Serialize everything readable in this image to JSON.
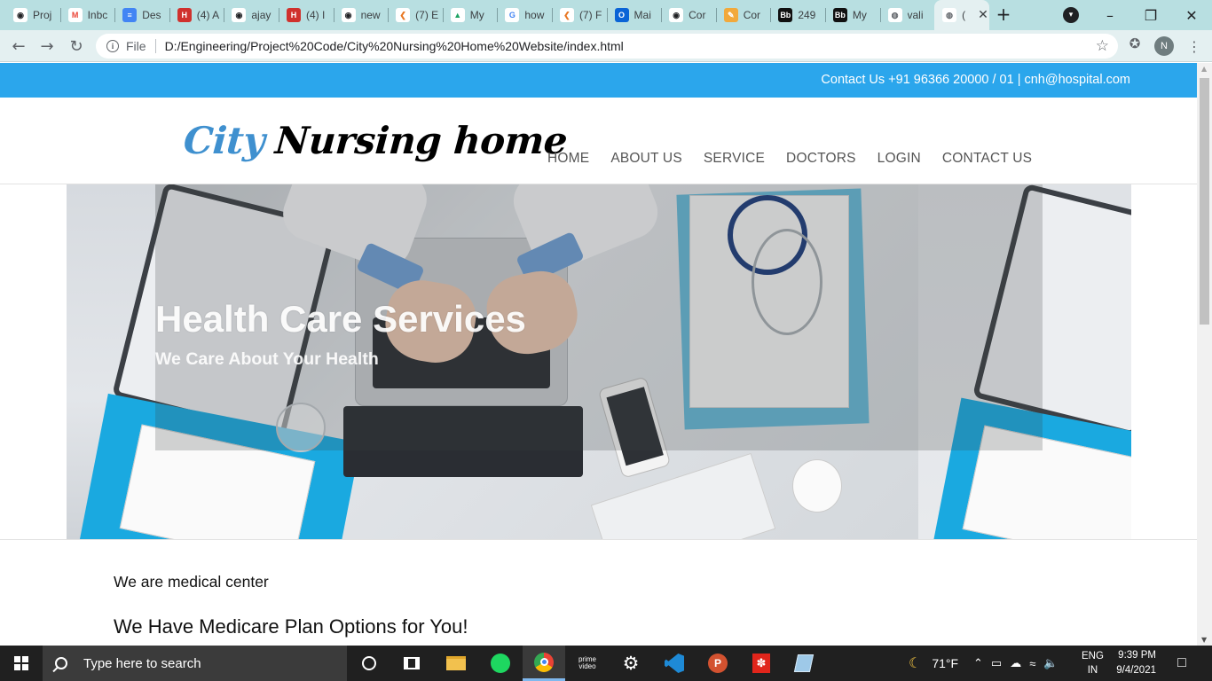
{
  "browser": {
    "tabs": [
      {
        "title": "Proj",
        "icon": "github-icon",
        "color": "#ffffff",
        "fg": "#202124",
        "glyph": "◉"
      },
      {
        "title": "Inbc",
        "icon": "gmail-icon",
        "color": "#ffffff",
        "fg": "#ea4335",
        "glyph": "M"
      },
      {
        "title": "Des",
        "icon": "docs-icon",
        "color": "#4285f4",
        "fg": "#ffffff",
        "glyph": "≡"
      },
      {
        "title": "(4) A",
        "icon": "hackerearth-icon",
        "color": "#d0312d",
        "fg": "#ffffff",
        "glyph": "H"
      },
      {
        "title": "ajay",
        "icon": "github-icon",
        "color": "#ffffff",
        "fg": "#202124",
        "glyph": "◉"
      },
      {
        "title": "(4) I",
        "icon": "hackerearth-icon",
        "color": "#d0312d",
        "fg": "#ffffff",
        "glyph": "H"
      },
      {
        "title": "new",
        "icon": "github-icon",
        "color": "#ffffff",
        "fg": "#202124",
        "glyph": "◉"
      },
      {
        "title": "(7) E",
        "icon": "leetcode-icon",
        "color": "#ffffff",
        "fg": "#e87722",
        "glyph": "❮"
      },
      {
        "title": "My",
        "icon": "drive-icon",
        "color": "#ffffff",
        "fg": "#1fa463",
        "glyph": "▲"
      },
      {
        "title": "how",
        "icon": "google-icon",
        "color": "#ffffff",
        "fg": "#4285f4",
        "glyph": "G"
      },
      {
        "title": "(7) F",
        "icon": "leetcode-icon",
        "color": "#ffffff",
        "fg": "#e87722",
        "glyph": "❮"
      },
      {
        "title": "Mai",
        "icon": "outlook-icon",
        "color": "#0a64d6",
        "fg": "#ffffff",
        "glyph": "O"
      },
      {
        "title": "Cor",
        "icon": "github-icon",
        "color": "#ffffff",
        "fg": "#202124",
        "glyph": "◉"
      },
      {
        "title": "Cor",
        "icon": "notepad-icon",
        "color": "#f2a93b",
        "fg": "#ffffff",
        "glyph": "✎"
      },
      {
        "title": "249",
        "icon": "blackboard-icon",
        "color": "#111111",
        "fg": "#ffffff",
        "glyph": "Bb"
      },
      {
        "title": "My",
        "icon": "blackboard-icon",
        "color": "#111111",
        "fg": "#ffffff",
        "glyph": "Bb"
      },
      {
        "title": "vali",
        "icon": "globe-icon",
        "color": "#ffffff",
        "fg": "#5f6368",
        "glyph": "◍"
      },
      {
        "title": "(",
        "icon": "globe-icon",
        "color": "#ffffff",
        "fg": "#5f6368",
        "glyph": "◍",
        "active": true
      }
    ],
    "new_tab": "+",
    "address": {
      "scheme": "File",
      "url": "D:/Engineering/Project%20Code/City%20Nursing%20Home%20Website/index.html"
    },
    "profile_initial": "N"
  },
  "site": {
    "contact_bar": "Contact Us +91 96366 20000 / 01 | cnh@hospital.com",
    "logo_word1": "City",
    "logo_word2": "Nursing home",
    "nav": [
      "HOME",
      "ABOUT US",
      "SERVICE",
      "DOCTORS",
      "LOGIN",
      "CONTACT US"
    ],
    "hero_title": "Health Care Services",
    "hero_subtitle": "We Care About Your Health",
    "intro": "We are medical center",
    "plan_heading": "We Have Medicare Plan Options for You!"
  },
  "taskbar": {
    "search_placeholder": "Type here to search",
    "weather": "71°F",
    "lang_line1": "ENG",
    "lang_line2": "IN",
    "time": "9:39 PM",
    "date": "9/4/2021"
  },
  "colors": {
    "topbar": "#2ba6ec",
    "logo_accent": "#3f90cf",
    "tabstrip": "#b8dfe1"
  }
}
